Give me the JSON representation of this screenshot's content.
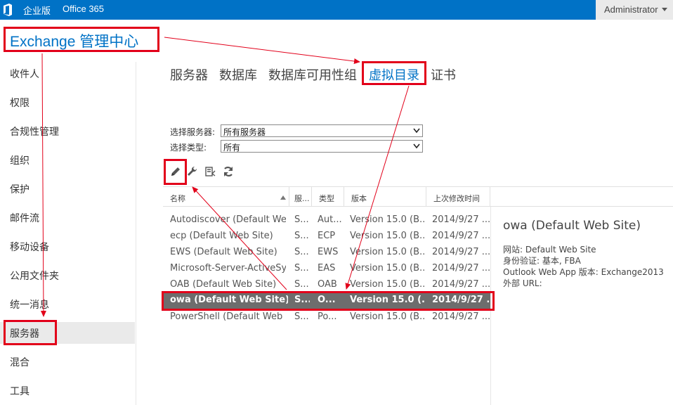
{
  "topbar": {
    "brand": "企业版",
    "office": "Office 365",
    "user": "Administrator"
  },
  "app": {
    "title": "Exchange 管理中心"
  },
  "nav": {
    "items": [
      {
        "label": "收件人"
      },
      {
        "label": "权限"
      },
      {
        "label": "合规性管理"
      },
      {
        "label": "组织"
      },
      {
        "label": "保护"
      },
      {
        "label": "邮件流"
      },
      {
        "label": "移动设备"
      },
      {
        "label": "公用文件夹"
      },
      {
        "label": "统一消息"
      },
      {
        "label": "服务器",
        "selected": true
      },
      {
        "label": "混合"
      },
      {
        "label": "工具"
      }
    ]
  },
  "tabs": [
    {
      "label": "服务器"
    },
    {
      "label": "数据库"
    },
    {
      "label": "数据库可用性组"
    },
    {
      "label": "虚拟目录",
      "active": true
    },
    {
      "label": "证书"
    }
  ],
  "filters": {
    "server_label": "选择服务器:",
    "server_value": "所有服务器",
    "type_label": "选择类型:",
    "type_value": "所有"
  },
  "toolbar": {
    "edit_icon": "pencil-icon",
    "configure_icon": "wrench-icon",
    "reset_icon": "reset-icon",
    "refresh_icon": "refresh-icon"
  },
  "table": {
    "columns": [
      "名称",
      "服...",
      "类型",
      "版本",
      "上次修改时间"
    ],
    "rows": [
      [
        "Autodiscover (Default We...",
        "S...",
        "Aut...",
        "Version 15.0 (B...",
        "2014/9/27 ..."
      ],
      [
        "ecp (Default Web Site)",
        "S...",
        "ECP",
        "Version 15.0 (B...",
        "2014/9/27 ..."
      ],
      [
        "EWS (Default Web Site)",
        "S...",
        "EWS",
        "Version 15.0 (B...",
        "2014/9/27 ..."
      ],
      [
        "Microsoft-Server-ActiveSy...",
        "S...",
        "EAS",
        "Version 15.0 (B...",
        "2014/9/27 ..."
      ],
      [
        "OAB (Default Web Site)",
        "S...",
        "OAB",
        "Version 15.0 (B...",
        "2014/9/27 ..."
      ],
      [
        "owa (Default Web Site)",
        "S...",
        "O...",
        "Version 15.0 (...",
        "2014/9/27 ..."
      ],
      [
        "PowerShell (Default Web ...",
        "S...",
        "Po...",
        "Version 15.0 (B...",
        "2014/9/27 ..."
      ]
    ],
    "selected_row": 5
  },
  "detail": {
    "title": "owa (Default Web Site)",
    "website": "网站: Default Web Site",
    "auth": "身份验证: 基本, FBA",
    "version": "Outlook Web App 版本: Exchange2013",
    "external_url": "外部 URL:"
  },
  "colors": {
    "topbar": "#0072c6",
    "accent": "#0072c6",
    "annotation": "#e2001a",
    "selected_row": "#6d6d6d"
  }
}
